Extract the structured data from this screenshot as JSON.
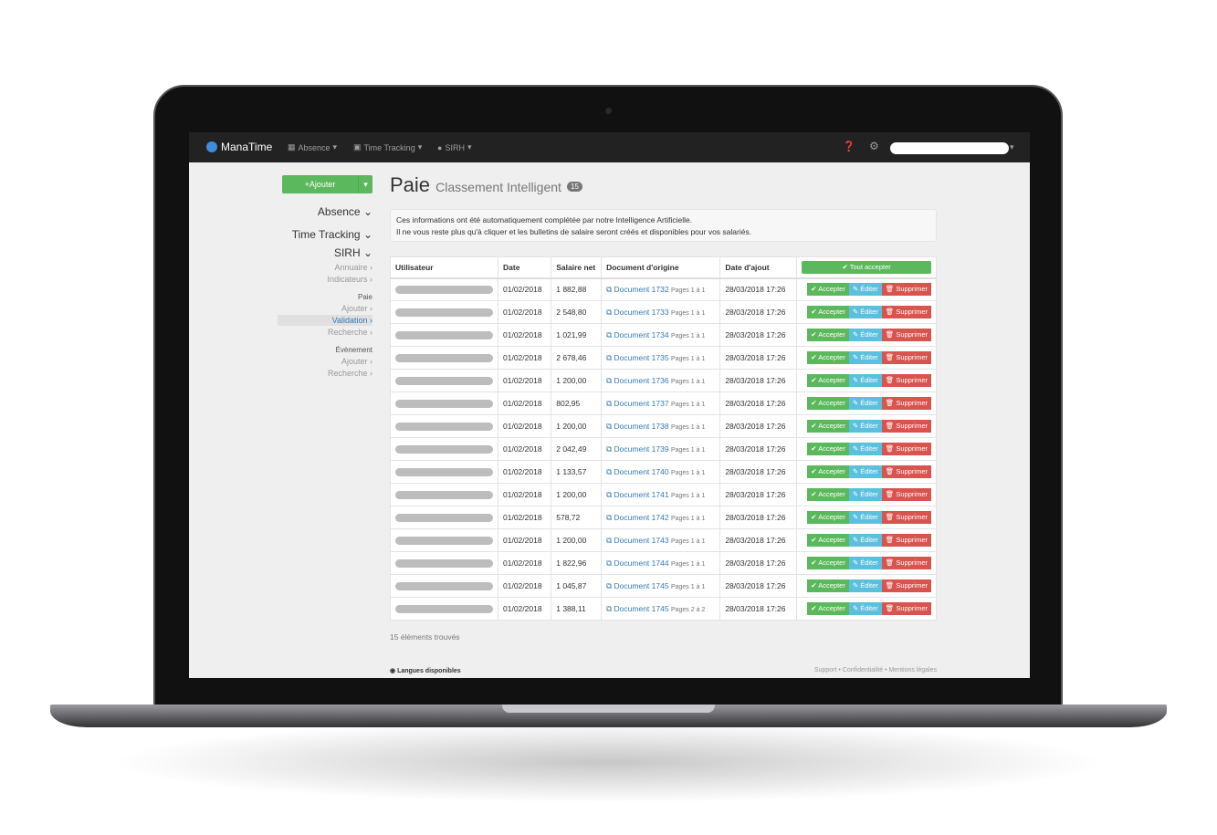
{
  "navbar": {
    "brand": "ManaTime",
    "menus": [
      {
        "label": "Absence",
        "icon": "calendar-icon"
      },
      {
        "label": "Time Tracking",
        "icon": "badge-icon"
      },
      {
        "label": "SIRH",
        "icon": "info-circle-icon"
      }
    ],
    "help_icon": "question-circle-icon",
    "settings_icon": "gear-icon"
  },
  "sidebar": {
    "add_button": "Ajouter",
    "sections": [
      {
        "label": "Absence"
      },
      {
        "label": "Time Tracking"
      },
      {
        "label": "SIRH"
      }
    ],
    "sirh_links": [
      "Annuaire ›",
      "Indicateurs ›"
    ],
    "paie": {
      "header": "Paie",
      "links": [
        "Ajouter ›",
        "Validation ›",
        "Recherche ›"
      ],
      "active": "Validation"
    },
    "evenement": {
      "header": "Évènement",
      "links": [
        "Ajouter ›",
        "Recherche ›"
      ]
    }
  },
  "page": {
    "title": "Paie",
    "subtitle": "Classement Intelligent",
    "badge": "15",
    "alert_line1": "Ces informations ont été automatiquement complétée par notre Intelligence Artificielle.",
    "alert_line2": "Il ne vous reste plus qu'à cliquer et les bulletins de salaire seront créés et disponibles pour vos salariés."
  },
  "table": {
    "headers": [
      "Utilisateur",
      "Date",
      "Salaire net",
      "Document d'origine",
      "Date d'ajout"
    ],
    "accept_all": "✔ Tout accepter",
    "actions": {
      "accept": "✔ Accepter",
      "edit": "✎ Éditer",
      "delete": "🗑 Supprimer"
    },
    "rows": [
      {
        "date": "01/02/2018",
        "salary": "1 882,88",
        "doc": "Document 1732",
        "pages": "Pages 1 à 1",
        "added": "28/03/2018 17:26"
      },
      {
        "date": "01/02/2018",
        "salary": "2 548,80",
        "doc": "Document 1733",
        "pages": "Pages 1 à 1",
        "added": "28/03/2018 17:26"
      },
      {
        "date": "01/02/2018",
        "salary": "1 021,99",
        "doc": "Document 1734",
        "pages": "Pages 1 à 1",
        "added": "28/03/2018 17:26"
      },
      {
        "date": "01/02/2018",
        "salary": "2 678,46",
        "doc": "Document 1735",
        "pages": "Pages 1 à 1",
        "added": "28/03/2018 17:26"
      },
      {
        "date": "01/02/2018",
        "salary": "1 200,00",
        "doc": "Document 1736",
        "pages": "Pages 1 à 1",
        "added": "28/03/2018 17:26"
      },
      {
        "date": "01/02/2018",
        "salary": "802,95",
        "doc": "Document 1737",
        "pages": "Pages 1 à 1",
        "added": "28/03/2018 17:26"
      },
      {
        "date": "01/02/2018",
        "salary": "1 200,00",
        "doc": "Document 1738",
        "pages": "Pages 1 à 1",
        "added": "28/03/2018 17:26"
      },
      {
        "date": "01/02/2018",
        "salary": "2 042,49",
        "doc": "Document 1739",
        "pages": "Pages 1 à 1",
        "added": "28/03/2018 17:26"
      },
      {
        "date": "01/02/2018",
        "salary": "1 133,57",
        "doc": "Document 1740",
        "pages": "Pages 1 à 1",
        "added": "28/03/2018 17:26"
      },
      {
        "date": "01/02/2018",
        "salary": "1 200,00",
        "doc": "Document 1741",
        "pages": "Pages 1 à 1",
        "added": "28/03/2018 17:26"
      },
      {
        "date": "01/02/2018",
        "salary": "578,72",
        "doc": "Document 1742",
        "pages": "Pages 1 à 1",
        "added": "28/03/2018 17:26"
      },
      {
        "date": "01/02/2018",
        "salary": "1 200,00",
        "doc": "Document 1743",
        "pages": "Pages 1 à 1",
        "added": "28/03/2018 17:26"
      },
      {
        "date": "01/02/2018",
        "salary": "1 822,96",
        "doc": "Document 1744",
        "pages": "Pages 1 à 1",
        "added": "28/03/2018 17:26"
      },
      {
        "date": "01/02/2018",
        "salary": "1 045,87",
        "doc": "Document 1745",
        "pages": "Pages 1 à 1",
        "added": "28/03/2018 17:26"
      },
      {
        "date": "01/02/2018",
        "salary": "1 388,11",
        "doc": "Document 1745",
        "pages": "Pages 2 à 2",
        "added": "28/03/2018 17:26"
      }
    ]
  },
  "footer": {
    "found": "15 éléments trouvés",
    "languages": "Langues disponibles",
    "links": "Support • Confidentialité • Mentions légales"
  },
  "colors": {
    "success": "#5cb85c",
    "info": "#5bc0de",
    "danger": "#d9534f",
    "link": "#337ab7",
    "navbar": "#222222"
  }
}
